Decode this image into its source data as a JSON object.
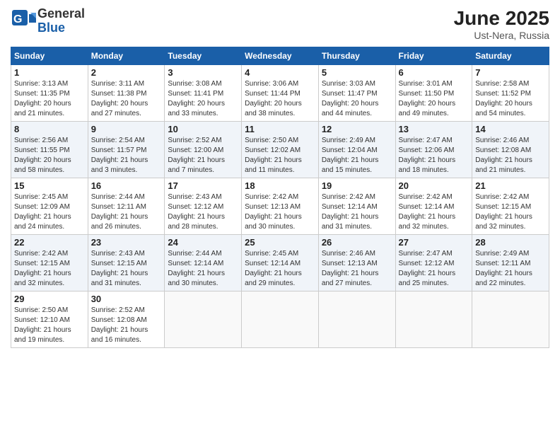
{
  "logo": {
    "general": "General",
    "blue": "Blue"
  },
  "title": "June 2025",
  "location": "Ust-Nera, Russia",
  "days_of_week": [
    "Sunday",
    "Monday",
    "Tuesday",
    "Wednesday",
    "Thursday",
    "Friday",
    "Saturday"
  ],
  "weeks": [
    [
      {
        "day": "1",
        "sunrise": "3:13 AM",
        "sunset": "11:35 PM",
        "daylight": "20 hours and 21 minutes."
      },
      {
        "day": "2",
        "sunrise": "3:11 AM",
        "sunset": "11:38 PM",
        "daylight": "20 hours and 27 minutes."
      },
      {
        "day": "3",
        "sunrise": "3:08 AM",
        "sunset": "11:41 PM",
        "daylight": "20 hours and 33 minutes."
      },
      {
        "day": "4",
        "sunrise": "3:06 AM",
        "sunset": "11:44 PM",
        "daylight": "20 hours and 38 minutes."
      },
      {
        "day": "5",
        "sunrise": "3:03 AM",
        "sunset": "11:47 PM",
        "daylight": "20 hours and 44 minutes."
      },
      {
        "day": "6",
        "sunrise": "3:01 AM",
        "sunset": "11:50 PM",
        "daylight": "20 hours and 49 minutes."
      },
      {
        "day": "7",
        "sunrise": "2:58 AM",
        "sunset": "11:52 PM",
        "daylight": "20 hours and 54 minutes."
      }
    ],
    [
      {
        "day": "8",
        "sunrise": "2:56 AM",
        "sunset": "11:55 PM",
        "daylight": "20 hours and 58 minutes."
      },
      {
        "day": "9",
        "sunrise": "2:54 AM",
        "sunset": "11:57 PM",
        "daylight": "21 hours and 3 minutes."
      },
      {
        "day": "10",
        "sunrise": "2:52 AM",
        "sunset": "12:00 AM",
        "daylight": "21 hours and 7 minutes."
      },
      {
        "day": "11",
        "sunrise": "2:50 AM",
        "sunset": "12:02 AM",
        "daylight": "21 hours and 11 minutes."
      },
      {
        "day": "12",
        "sunrise": "2:49 AM",
        "sunset": "12:04 AM",
        "daylight": "21 hours and 15 minutes."
      },
      {
        "day": "13",
        "sunrise": "2:47 AM",
        "sunset": "12:06 AM",
        "daylight": "21 hours and 18 minutes."
      },
      {
        "day": "14",
        "sunrise": "2:46 AM",
        "sunset": "12:08 AM",
        "daylight": "21 hours and 21 minutes."
      }
    ],
    [
      {
        "day": "15",
        "sunrise": "2:45 AM",
        "sunset": "12:09 AM",
        "daylight": "21 hours and 24 minutes."
      },
      {
        "day": "16",
        "sunrise": "2:44 AM",
        "sunset": "12:11 AM",
        "daylight": "21 hours and 26 minutes."
      },
      {
        "day": "17",
        "sunrise": "2:43 AM",
        "sunset": "12:12 AM",
        "daylight": "21 hours and 28 minutes."
      },
      {
        "day": "18",
        "sunrise": "2:42 AM",
        "sunset": "12:13 AM",
        "daylight": "21 hours and 30 minutes."
      },
      {
        "day": "19",
        "sunrise": "2:42 AM",
        "sunset": "12:14 AM",
        "daylight": "21 hours and 31 minutes."
      },
      {
        "day": "20",
        "sunrise": "2:42 AM",
        "sunset": "12:14 AM",
        "daylight": "21 hours and 32 minutes."
      },
      {
        "day": "21",
        "sunrise": "2:42 AM",
        "sunset": "12:15 AM",
        "daylight": "21 hours and 32 minutes."
      }
    ],
    [
      {
        "day": "22",
        "sunrise": "2:42 AM",
        "sunset": "12:15 AM",
        "daylight": "21 hours and 32 minutes."
      },
      {
        "day": "23",
        "sunrise": "2:43 AM",
        "sunset": "12:15 AM",
        "daylight": "21 hours and 31 minutes."
      },
      {
        "day": "24",
        "sunrise": "2:44 AM",
        "sunset": "12:14 AM",
        "daylight": "21 hours and 30 minutes."
      },
      {
        "day": "25",
        "sunrise": "2:45 AM",
        "sunset": "12:14 AM",
        "daylight": "21 hours and 29 minutes."
      },
      {
        "day": "26",
        "sunrise": "2:46 AM",
        "sunset": "12:13 AM",
        "daylight": "21 hours and 27 minutes."
      },
      {
        "day": "27",
        "sunrise": "2:47 AM",
        "sunset": "12:12 AM",
        "daylight": "21 hours and 25 minutes."
      },
      {
        "day": "28",
        "sunrise": "2:49 AM",
        "sunset": "12:11 AM",
        "daylight": "21 hours and 22 minutes."
      }
    ],
    [
      {
        "day": "29",
        "sunrise": "2:50 AM",
        "sunset": "12:10 AM",
        "daylight": "21 hours and 19 minutes."
      },
      {
        "day": "30",
        "sunrise": "2:52 AM",
        "sunset": "12:08 AM",
        "daylight": "21 hours and 16 minutes."
      },
      null,
      null,
      null,
      null,
      null
    ]
  ]
}
